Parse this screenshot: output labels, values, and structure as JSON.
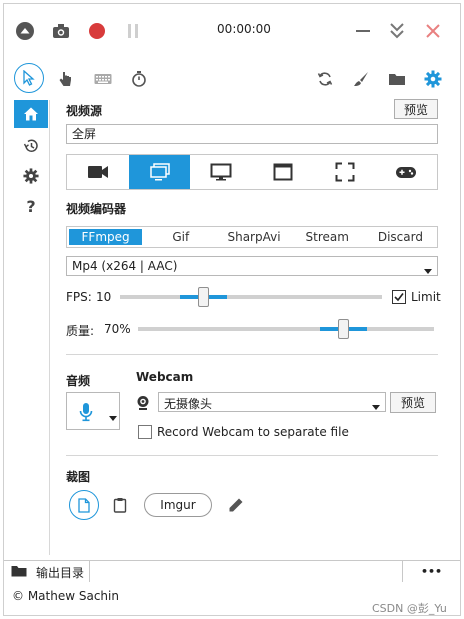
{
  "titlebar": {
    "timer": "00:00:00",
    "icons": [
      "collapse-icon",
      "camera-icon",
      "record-icon",
      "pause-icon",
      "minimize-icon",
      "chevron-double-down-icon",
      "close-icon"
    ]
  },
  "toolbar": {
    "icons": [
      "cursor-icon",
      "hand-click-icon",
      "keyboard-icon",
      "stopwatch-icon",
      "refresh-icon",
      "brush-icon",
      "folder-icon",
      "settings-icon"
    ]
  },
  "sidebar": {
    "items": [
      "home-icon",
      "history-icon",
      "settings-icon",
      "help-icon"
    ],
    "help_glyph": "?"
  },
  "video_source": {
    "label": "视频源",
    "preview_button": "预览",
    "current": "全屏",
    "sources": [
      "camera-icon",
      "screen-icon",
      "monitor-icon",
      "window-icon",
      "region-icon",
      "gamepad-icon"
    ],
    "active_index": 1
  },
  "encoder": {
    "label": "视频编码器",
    "tabs": [
      "FFmpeg",
      "Gif",
      "SharpAvi",
      "Stream",
      "Discard"
    ],
    "active_index": 0,
    "format": "Mp4 (x264 | AAC)",
    "fps_label": "FPS:",
    "fps_value": "10",
    "fps_fraction": 0.31,
    "limit_label": "Limit",
    "limit_checked": true,
    "quality_label": "质量:",
    "quality_value": "70%",
    "quality_fraction": 0.7
  },
  "audio": {
    "label": "音频"
  },
  "webcam": {
    "label": "Webcam",
    "device": "无摄像头",
    "preview_button": "预览",
    "separate_file_label": "Record Webcam to separate file",
    "separate_file_checked": false
  },
  "screenshot": {
    "label": "裁图",
    "imgur_button": "Imgur"
  },
  "statusbar": {
    "output_dir_label": "输出目录",
    "more_glyph": "•••"
  },
  "footer": {
    "credit": "© Mathew Sachin",
    "watermark": "CSDN @彭_Yu"
  },
  "colors": {
    "accent": "#1f96da",
    "record": "#d83b3b",
    "close": "#e88080"
  }
}
